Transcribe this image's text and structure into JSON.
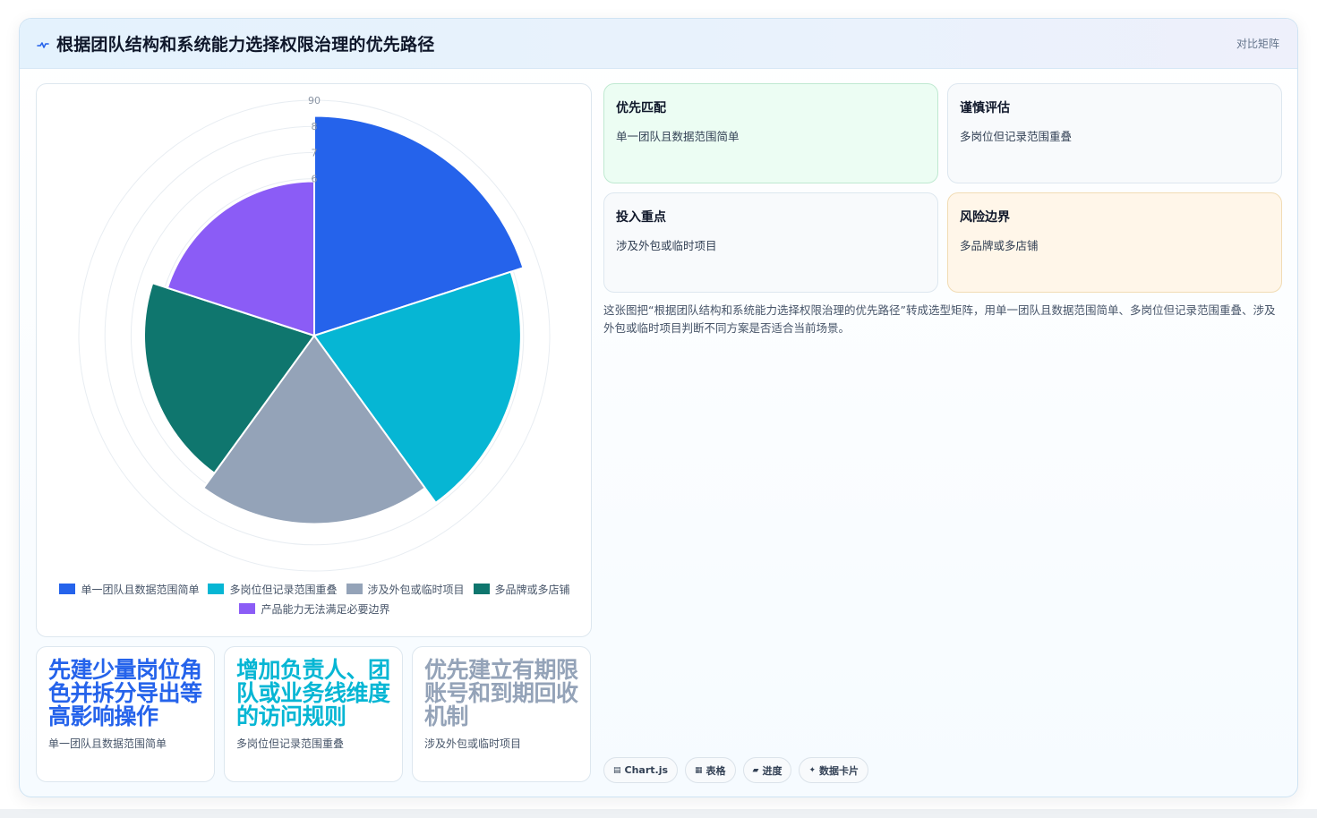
{
  "header": {
    "icon": "pulse-icon",
    "title": "根据团队结构和系统能力选择权限治理的优先路径",
    "tag": "对比矩阵"
  },
  "chart_data": {
    "type": "polarArea",
    "categories": [
      "单一团队且数据范围简单",
      "多岗位但记录范围重叠",
      "涉及外包或临时项目",
      "多品牌或多店铺",
      "产品能力无法满足必要边界"
    ],
    "values": [
      84,
      79,
      72,
      65,
      59
    ],
    "colors": [
      "#2563eb",
      "#06b6d4",
      "#94a3b8",
      "#0f766e",
      "#8b5cf6"
    ],
    "r_min": 50,
    "r_max": 90,
    "ticks": [
      "90",
      "8",
      "7",
      "6"
    ],
    "legend_position": "bottom"
  },
  "stats": [
    {
      "value": "先建少量岗位角色并拆分导出等高影响操作",
      "label": "单一团队且数据范围简单",
      "color": "#2563eb"
    },
    {
      "value": "增加负责人、团队或业务线维度的访问规则",
      "label": "多岗位但记录范围重叠",
      "color": "#06b6d4"
    },
    {
      "value": "优先建立有期限账号和到期回收机制",
      "label": "涉及外包或临时项目",
      "color": "#94a3b8"
    }
  ],
  "quadrants": [
    {
      "title": "优先匹配",
      "desc": "单一团队且数据范围简单",
      "bg": "#ecfdf3",
      "border": "#bfe9d1"
    },
    {
      "title": "谨慎评估",
      "desc": "多岗位但记录范围重叠",
      "bg": "#f8fafc",
      "border": "#dde7ef"
    },
    {
      "title": "投入重点",
      "desc": "涉及外包或临时项目",
      "bg": "#f8fafc",
      "border": "#dde7ef"
    },
    {
      "title": "风险边界",
      "desc": "多品牌或多店铺",
      "bg": "#fff6e9",
      "border": "#f1dcb4"
    }
  ],
  "description": "这张图把“根据团队结构和系统能力选择权限治理的优先路径”转成选型矩阵，用单一团队且数据范围简单、多岗位但记录范围重叠、涉及外包或临时项目判断不同方案是否适合当前场景。",
  "chips": [
    {
      "icon": "▤",
      "label": "Chart.js"
    },
    {
      "icon": "▦",
      "label": "表格"
    },
    {
      "icon": "▰",
      "label": "进度"
    },
    {
      "icon": "✦",
      "label": "数据卡片"
    }
  ]
}
